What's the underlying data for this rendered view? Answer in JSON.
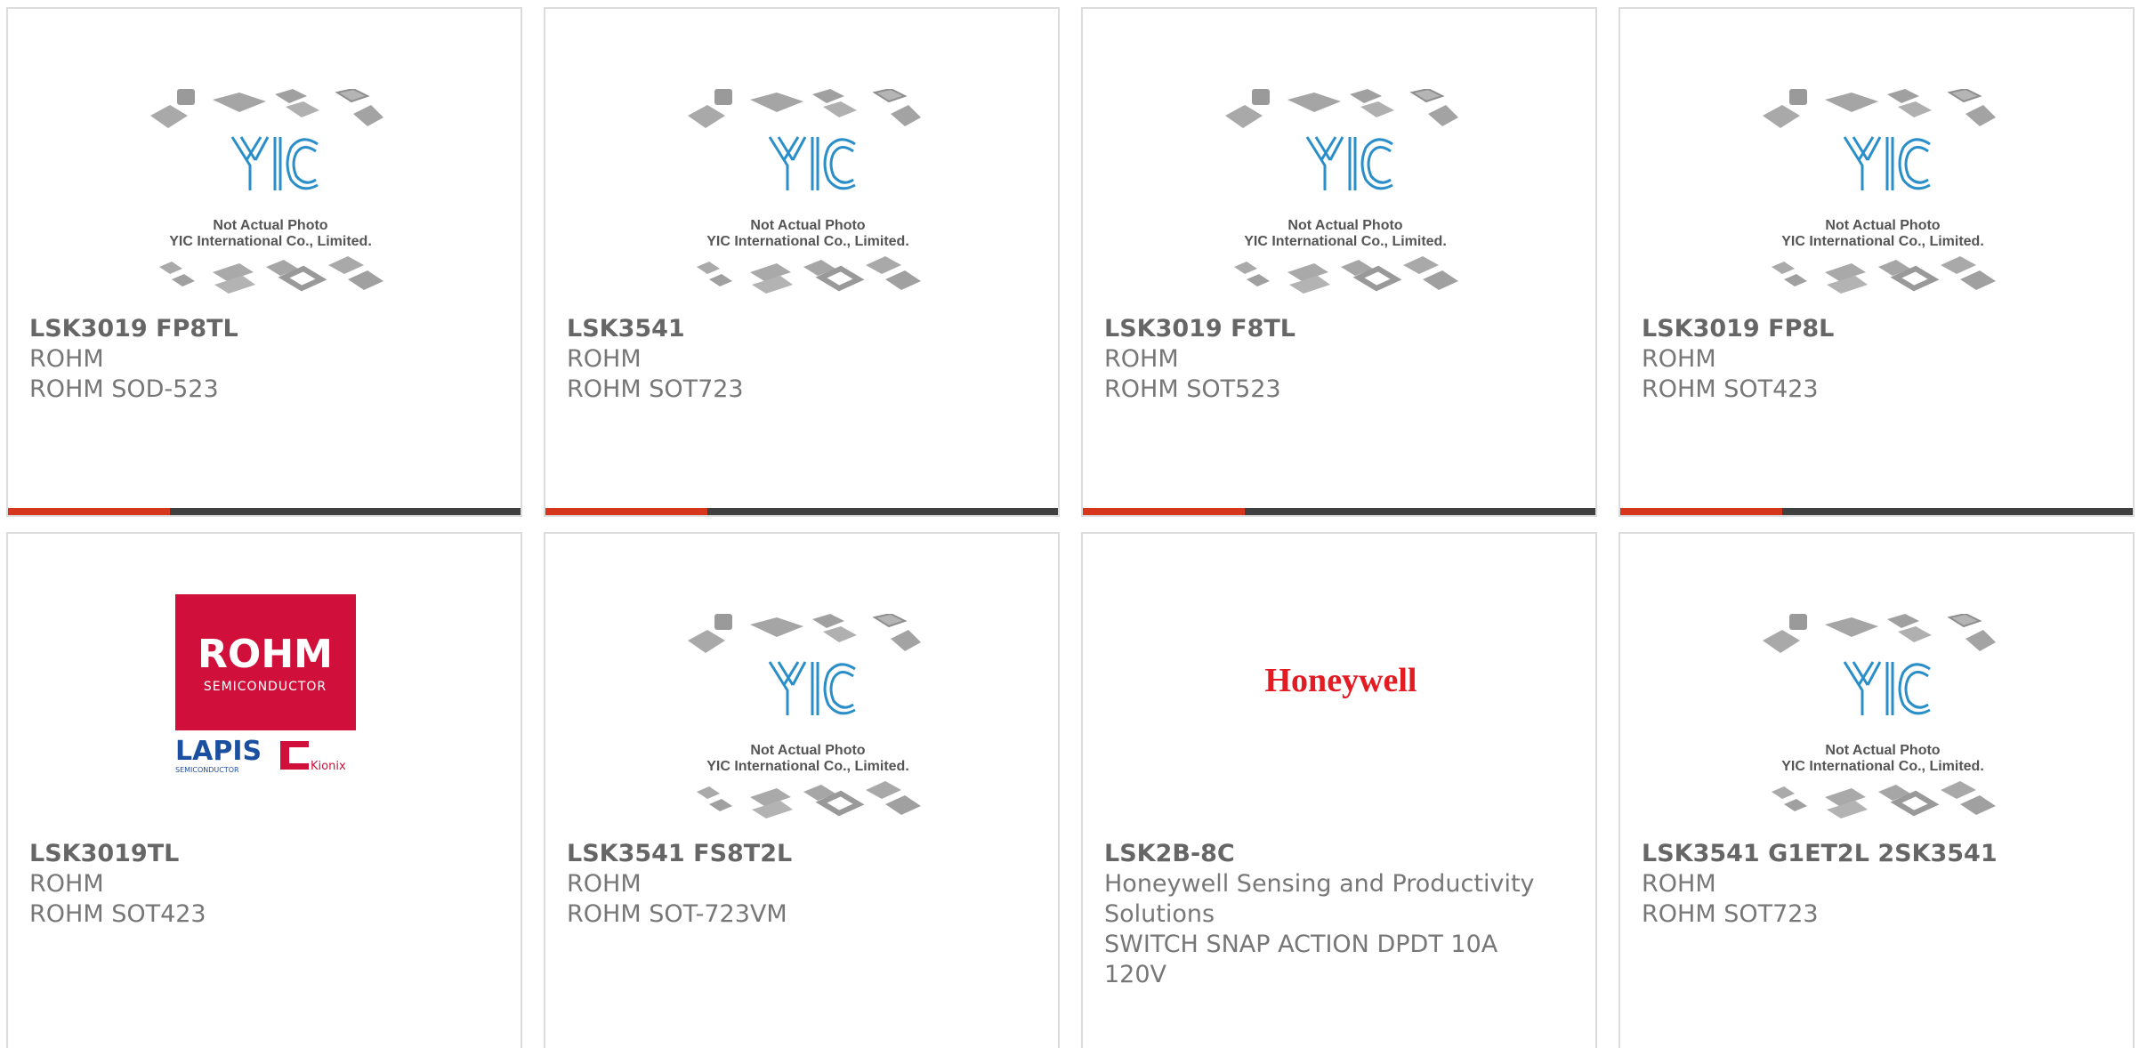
{
  "colors": {
    "accent": "#d6361b",
    "bar": "#404040",
    "border": "#dcdcdc",
    "text": "#777777"
  },
  "placeholder": {
    "line1": "Not Actual Photo",
    "line2": "YIC International Co., Limited.",
    "logo_text": "YIC"
  },
  "rohm_logo": {
    "brand": "ROHM",
    "sub": "SEMICONDUCTOR",
    "lapis": "LAPIS",
    "lapis_sub": "SEMICONDUCTOR",
    "kionix": "Kionix"
  },
  "honeywell_logo": {
    "text": "Honeywell"
  },
  "products": [
    {
      "part": "LSK3019 FP8TL",
      "manufacturer": "ROHM",
      "description": "ROHM SOD-523"
    },
    {
      "part": "LSK3541",
      "manufacturer": "ROHM",
      "description": "ROHM SOT723"
    },
    {
      "part": "LSK3019 F8TL",
      "manufacturer": "ROHM",
      "description": "ROHM SOT523"
    },
    {
      "part": "LSK3019 FP8L",
      "manufacturer": "ROHM",
      "description": "ROHM SOT423"
    },
    {
      "part": "LSK3019TL",
      "manufacturer": "ROHM",
      "description": "ROHM SOT423"
    },
    {
      "part": "LSK3541 FS8T2L",
      "manufacturer": "ROHM",
      "description": "ROHM SOT-723VM"
    },
    {
      "part": "LSK2B-8C",
      "manufacturer": "Honeywell Sensing and Productivity Solutions",
      "description": "SWITCH SNAP ACTION DPDT 10A 120V"
    },
    {
      "part": "LSK3541 G1ET2L 2SK3541",
      "manufacturer": "ROHM",
      "description": "ROHM SOT723"
    }
  ]
}
